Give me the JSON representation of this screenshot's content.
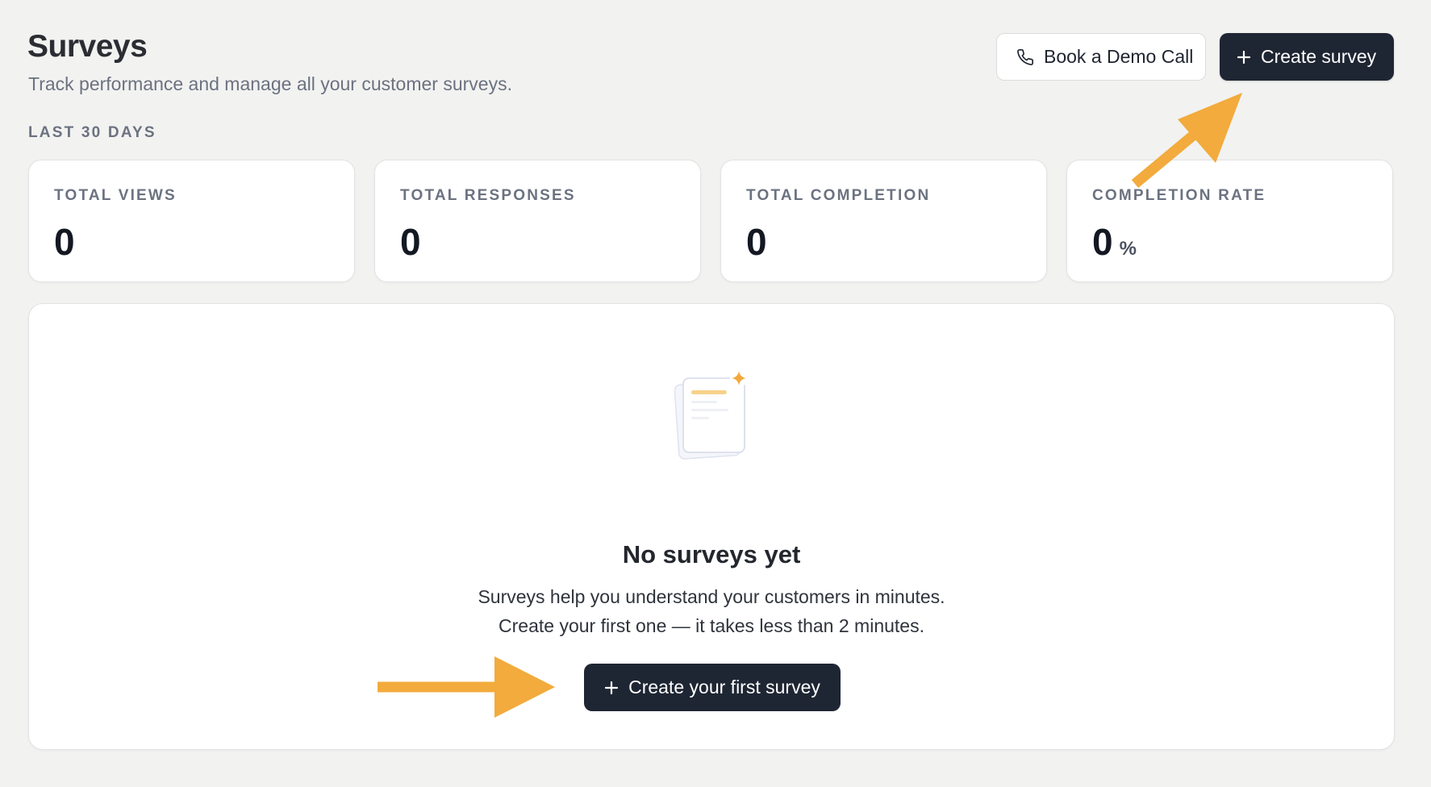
{
  "header": {
    "title": "Surveys",
    "subtitle": "Track performance and manage all your customer surveys.",
    "demo_button_label": "Book a Demo Call",
    "create_button_label": "Create survey"
  },
  "stats": {
    "period_label": "LAST 30 DAYS",
    "cards": [
      {
        "label": "TOTAL VIEWS",
        "value": "0"
      },
      {
        "label": "TOTAL RESPONSES",
        "value": "0"
      },
      {
        "label": "TOTAL COMPLETION",
        "value": "0"
      },
      {
        "label": "COMPLETION RATE",
        "value": "0",
        "unit": "%"
      }
    ]
  },
  "empty_state": {
    "title": "No surveys yet",
    "description_line1": "Surveys help you understand your customers in minutes.",
    "description_line2": "Create your first one — it takes less than 2 minutes.",
    "cta_label": "Create your first survey"
  },
  "icons": {
    "phone": "phone-icon",
    "plus": "plus-icon",
    "illustration": "document-stack-sparkle-icon",
    "annotation_arrows": "arrow-icon"
  },
  "colors": {
    "background": "#f2f2f1",
    "primary_button": "#1f2633",
    "annotation_arrow": "#f2ab3c",
    "muted_text": "#6b7280"
  }
}
